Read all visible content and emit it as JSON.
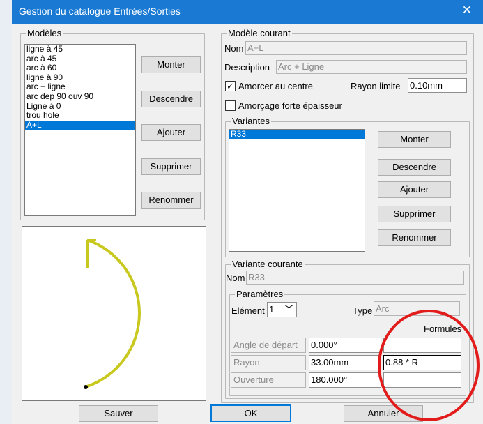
{
  "window": {
    "title": "Gestion du catalogue Entrées/Sorties",
    "close_glyph": "✕"
  },
  "models": {
    "legend": "Modèles",
    "items": [
      "ligne à 45",
      "arc à 45",
      "arc à 60",
      "ligne à 90",
      "arc + ligne",
      "arc dep 90 ouv 90",
      "Ligne à 0",
      "trou hole",
      "A+L"
    ],
    "selected_index": 8,
    "buttons": {
      "up": "Monter",
      "down": "Descendre",
      "add": "Ajouter",
      "delete": "Supprimer",
      "rename": "Renommer"
    }
  },
  "current_model": {
    "legend": "Modèle courant",
    "name_label": "Nom",
    "name_value": "A+L",
    "description_label": "Description",
    "description_value": "Arc + Ligne",
    "center_check_label": "Amorcer au centre",
    "center_checked": true,
    "radius_limit_label": "Rayon limite",
    "radius_limit_value": "0.10mm",
    "thick_check_label": "Amorçage forte épaisseur",
    "thick_checked": false
  },
  "variants": {
    "legend": "Variantes",
    "items": [
      "R33"
    ],
    "selected_index": 0,
    "buttons": {
      "up": "Monter",
      "down": "Descendre",
      "add": "Ajouter",
      "delete": "Supprimer",
      "rename": "Renommer"
    }
  },
  "current_variant": {
    "legend": "Variante courante",
    "name_label": "Nom",
    "name_value": "R33",
    "params": {
      "legend": "Paramètres",
      "element_label": "Elément",
      "element_value": "1",
      "type_label": "Type",
      "type_value": "Arc",
      "formulas_label": "Formules",
      "rows": [
        {
          "label": "Angle de départ",
          "value": "0.000°",
          "formula": ""
        },
        {
          "label": "Rayon",
          "value": "33.00mm",
          "formula": "0.88 * R"
        },
        {
          "label": "Ouverture",
          "value": "180.000°",
          "formula": ""
        }
      ]
    }
  },
  "footer": {
    "save": "Sauver",
    "ok": "OK",
    "cancel": "Annuler"
  },
  "colors": {
    "accent": "#0078d7",
    "preview_stroke": "#c8c81e",
    "annotation_circle": "#e21b1b"
  }
}
